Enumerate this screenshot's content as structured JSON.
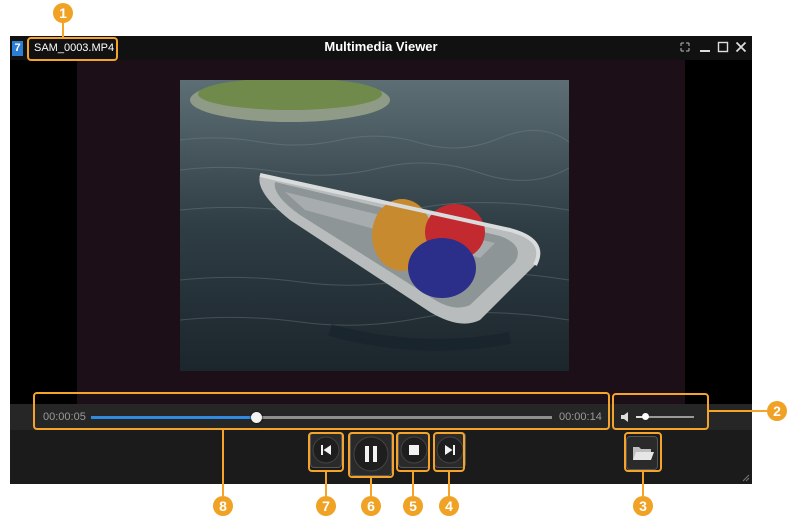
{
  "window": {
    "app_title": "Multimedia Viewer",
    "filename": "SAM_0003.MP4",
    "icon_glyph": "7"
  },
  "playback": {
    "current_time": "00:00:05",
    "total_time": "00:00:14",
    "progress": 0.357,
    "volume": 0.15
  },
  "controls": {
    "previous": "previous-track-icon",
    "pause": "pause-icon",
    "stop": "stop-icon",
    "next": "next-track-icon",
    "open": "folder-open-icon"
  },
  "callouts": [
    "1",
    "2",
    "3",
    "4",
    "5",
    "6",
    "7",
    "8"
  ],
  "colors": {
    "accent": "#f4a32b",
    "progress": "#2e8be0"
  }
}
